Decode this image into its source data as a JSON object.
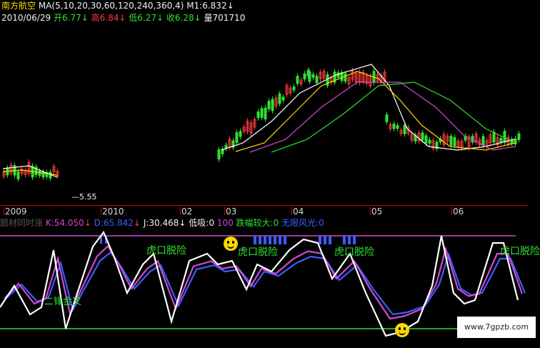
{
  "header": {
    "stock_name": "南方航空",
    "ma_params": "MA(5,10,20,30,60,120,240,360,4)",
    "m1": "M1:6.832",
    "date": "2010/06/29",
    "open_label": "开",
    "open": "6.77",
    "high_label": "高",
    "high": "6.84",
    "low_label": "低",
    "low": "6.27",
    "close_label": "收",
    "close": "6.28",
    "vol_label": "量",
    "vol": "701710",
    "down_arrow": "↓",
    "min_price_label": "5.55"
  },
  "x_axis_ticks": [
    "2009",
    "2010",
    "02",
    "03",
    "04",
    "05",
    "06"
  ],
  "indicator_line": {
    "name": "题材同时涨",
    "k": "K:54.050",
    "d": "D:65.842",
    "j": "J:30.468",
    "low_absorb": "低吸:0",
    "value_100": "100",
    "drop_big": "跌幅较大:0",
    "no_limit": "无限风光:0"
  },
  "chart_tags": [
    "虎口脱险",
    "虎口脱险",
    "虎口脱险",
    "虎口脱险",
    "二锋金叉"
  ],
  "watermark": "www.7gpzb.com",
  "colors": {
    "k_line": "#ffffff",
    "d_line": "#d04ad0",
    "j_line": "#3d5cff",
    "up": "#ff3b3b",
    "down": "#30e030"
  },
  "chart_data": {
    "type": "line",
    "title": "",
    "x_ticks": [
      "2009",
      "2010",
      "02",
      "03",
      "04",
      "05",
      "06"
    ],
    "price": {
      "last_close": 6.28,
      "open": 6.77,
      "high": 6.84,
      "low": 6.27,
      "period_low": 5.55,
      "series": [
        {
          "name": "MA5",
          "values": []
        },
        {
          "name": "MA10",
          "values": []
        }
      ]
    },
    "kdj": {
      "series": [
        {
          "name": "K",
          "last": 54.05
        },
        {
          "name": "D",
          "last": 65.842
        },
        {
          "name": "J",
          "last": 30.468
        }
      ],
      "upper_line": 100,
      "lower_line": 0
    }
  }
}
